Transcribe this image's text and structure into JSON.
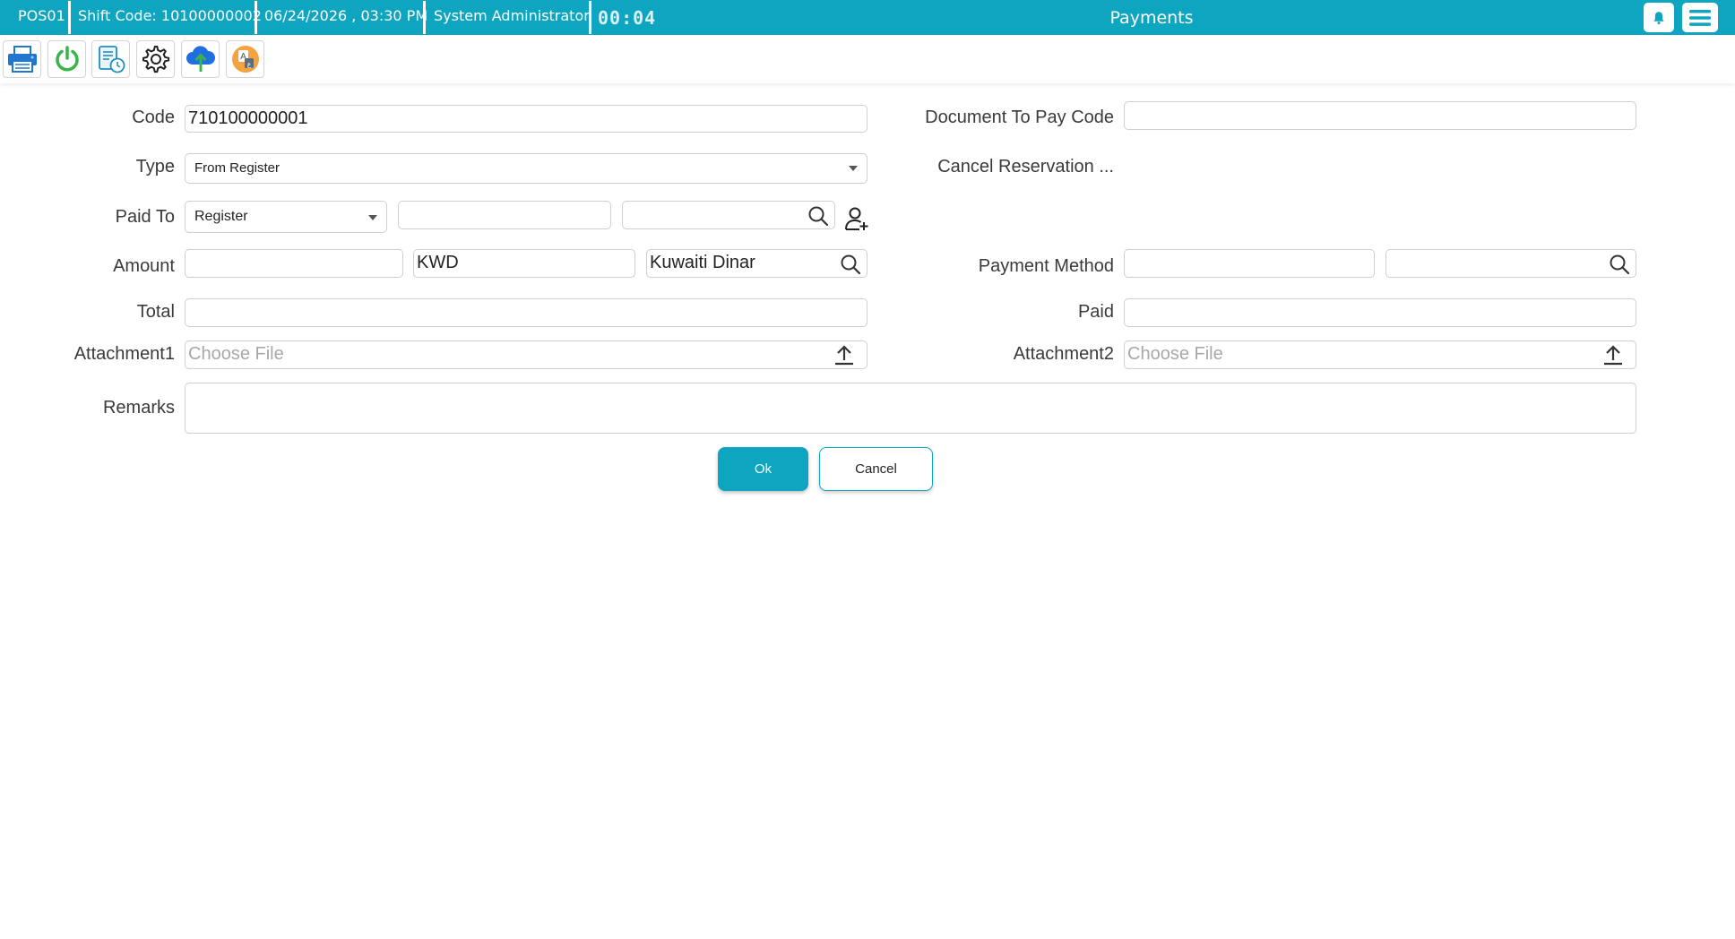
{
  "header": {
    "pos": "POS01",
    "shift": "Shift Code: 10100000002",
    "datetime": "06/24/2026 , 03:30 PM",
    "user": "System Administrator",
    "timer": "00:04",
    "title": "Payments"
  },
  "toolbar": {
    "tools": [
      "printer-icon",
      "power-icon",
      "report-clock-icon",
      "settings-gear-icon",
      "cloud-upload-icon",
      "language-icon"
    ]
  },
  "form": {
    "code": {
      "label": "Code",
      "value": "710100000001"
    },
    "document_to_pay": {
      "label": "Document To Pay Code",
      "value": ""
    },
    "type": {
      "label": "Type",
      "value": "From Register"
    },
    "cancel_reservation": {
      "label": "Cancel Reservation ..."
    },
    "paid_to": {
      "label": "Paid To",
      "select_value": "Register",
      "code_value": "",
      "search_value": ""
    },
    "amount": {
      "label": "Amount",
      "value": "",
      "currency_code": "KWD",
      "currency_name": "Kuwaiti Dinar"
    },
    "payment_method": {
      "label": "Payment Method",
      "code_value": "",
      "search_value": ""
    },
    "total": {
      "label": "Total",
      "value": ""
    },
    "paid": {
      "label": "Paid",
      "value": ""
    },
    "attachment1": {
      "label": "Attachment1",
      "placeholder": "Choose File"
    },
    "attachment2": {
      "label": "Attachment2",
      "placeholder": "Choose File"
    },
    "remarks": {
      "label": "Remarks",
      "value": ""
    }
  },
  "actions": {
    "ok": "Ok",
    "cancel": "Cancel"
  },
  "colors": {
    "accent": "#0ea5c1",
    "print_blue": "#1f77d0",
    "power_green": "#3bb54a",
    "lang_orange": "#f4a340"
  }
}
